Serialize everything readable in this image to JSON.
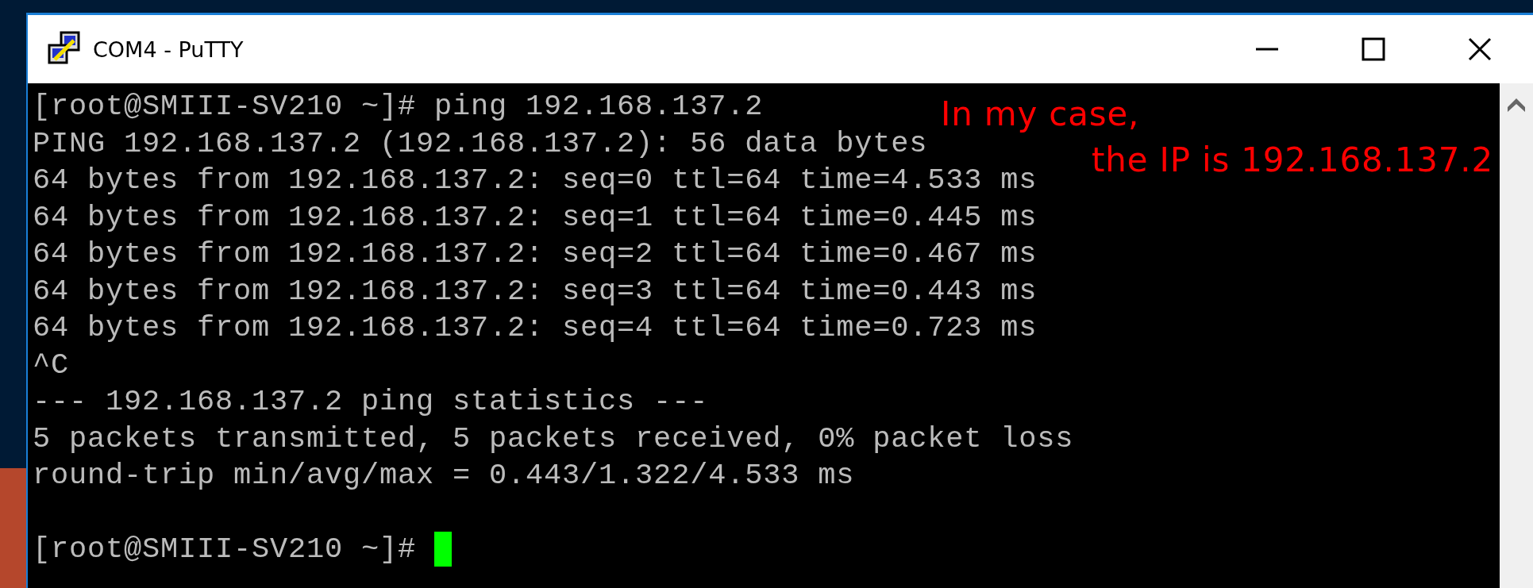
{
  "window": {
    "title": "COM4 - PuTTY"
  },
  "terminal": {
    "lines": [
      {
        "kind": "text",
        "text": "[root@SMIII-SV210 ~]# ping 192.168.137.2",
        "cursor": false
      },
      {
        "kind": "text",
        "text": "PING 192.168.137.2 (192.168.137.2): 56 data bytes",
        "cursor": false
      },
      {
        "kind": "text",
        "text": "64 bytes from 192.168.137.2: seq=0 ttl=64 time=4.533 ms",
        "cursor": false
      },
      {
        "kind": "text",
        "text": "64 bytes from 192.168.137.2: seq=1 ttl=64 time=0.445 ms",
        "cursor": false
      },
      {
        "kind": "text",
        "text": "64 bytes from 192.168.137.2: seq=2 ttl=64 time=0.467 ms",
        "cursor": false
      },
      {
        "kind": "text",
        "text": "64 bytes from 192.168.137.2: seq=3 ttl=64 time=0.443 ms",
        "cursor": false
      },
      {
        "kind": "text",
        "text": "64 bytes from 192.168.137.2: seq=4 ttl=64 time=0.723 ms",
        "cursor": false
      },
      {
        "kind": "text",
        "text": "^C",
        "cursor": false
      },
      {
        "kind": "text",
        "text": "--- 192.168.137.2 ping statistics ---",
        "cursor": false
      },
      {
        "kind": "text",
        "text": "5 packets transmitted, 5 packets received, 0% packet loss",
        "cursor": false
      },
      {
        "kind": "text",
        "text": "round-trip min/avg/max = 0.443/1.322/4.533 ms",
        "cursor": false
      },
      {
        "kind": "blank"
      },
      {
        "kind": "text",
        "text": "[root@SMIII-SV210 ~]# ",
        "cursor": true
      }
    ]
  },
  "annotation": {
    "lines": [
      "In my case,",
      "the IP is 192.168.137.2"
    ]
  }
}
